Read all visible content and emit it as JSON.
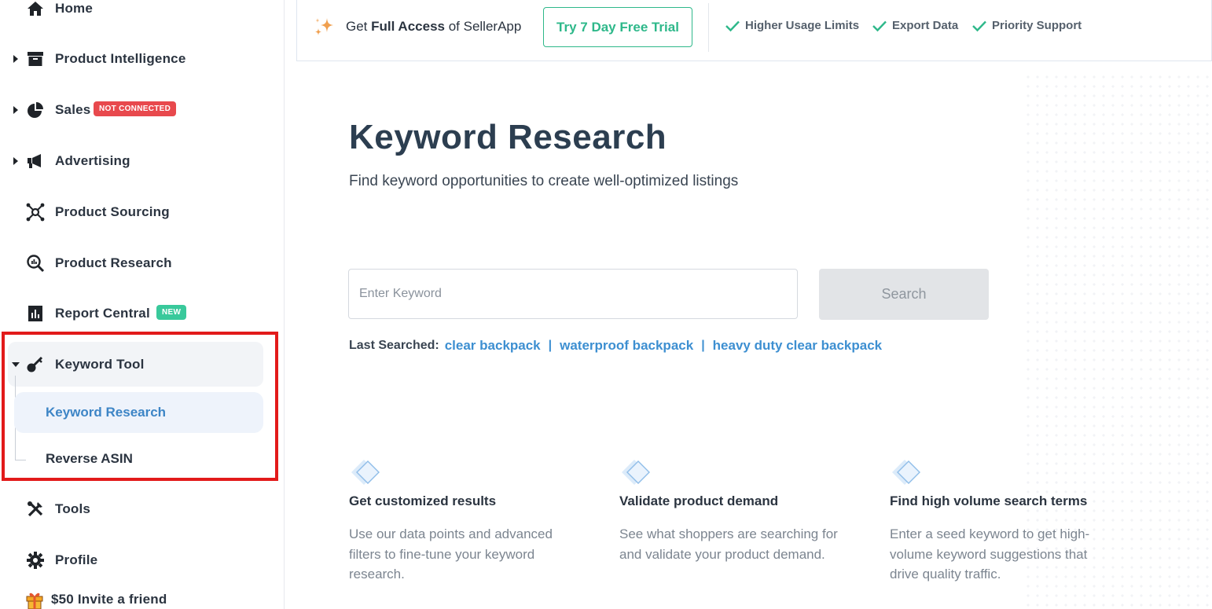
{
  "sidebar": {
    "items": [
      {
        "label": "Home",
        "icon": "home-icon"
      },
      {
        "label": "Product Intelligence",
        "icon": "archive-box-icon"
      },
      {
        "label": "Sales",
        "icon": "pie-chart-icon",
        "badge": "NOT CONNECTED"
      },
      {
        "label": "Advertising",
        "icon": "megaphone-icon"
      },
      {
        "label": "Product Sourcing",
        "icon": "network-hub-icon"
      },
      {
        "label": "Product Research",
        "icon": "search-chart-icon"
      },
      {
        "label": "Report Central",
        "icon": "report-icon",
        "badge": "NEW"
      },
      {
        "label": "Keyword Tool",
        "icon": "key-icon"
      },
      {
        "label": "Tools",
        "icon": "tools-icon"
      },
      {
        "label": "Profile",
        "icon": "gear-icon"
      },
      {
        "label": "$50 Invite a friend",
        "icon": "gift-icon"
      }
    ],
    "keyword_tool_sub": [
      {
        "label": "Keyword Research",
        "active": true
      },
      {
        "label": "Reverse ASIN",
        "active": false
      }
    ]
  },
  "banner": {
    "promo_prefix": "Get ",
    "promo_bold": "Full Access",
    "promo_suffix": " of SellerApp",
    "trial_button": "Try 7 Day Free Trial",
    "features": [
      "Higher Usage Limits",
      "Export Data",
      "Priority Support"
    ]
  },
  "main": {
    "title": "Keyword Research",
    "subtitle": "Find keyword opportunities to create well-optimized listings",
    "search": {
      "placeholder": "Enter Keyword",
      "value": "",
      "button": "Search"
    },
    "last_searched_label": "Last Searched:",
    "last_searched": [
      "clear backpack",
      "waterproof backpack",
      "heavy duty clear backpack"
    ],
    "features": [
      {
        "title": "Get customized results",
        "desc": "Use our data points and advanced filters to fine-tune your keyword research."
      },
      {
        "title": "Validate product demand",
        "desc": "See what shoppers are searching for and validate your product demand."
      },
      {
        "title": "Find high volume search terms",
        "desc": "Enter a seed keyword to get high-volume keyword suggestions that drive quality traffic."
      }
    ]
  },
  "colors": {
    "accent_green": "#2eb88a",
    "accent_blue": "#3d85c6",
    "badge_red": "#e8494d",
    "highlight_red": "#e21a1a"
  }
}
